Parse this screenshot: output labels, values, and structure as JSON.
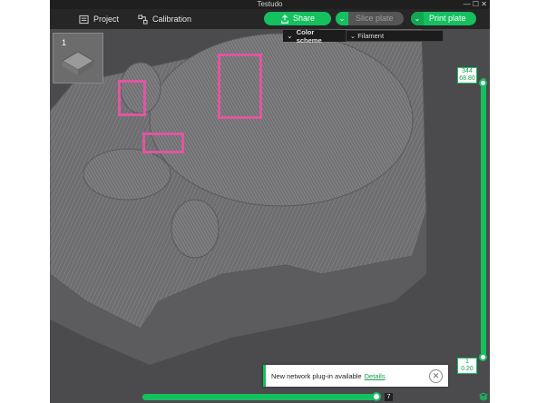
{
  "window": {
    "title": "Testudo",
    "min": "—",
    "max": "☐",
    "close": "✕"
  },
  "toolbar": {
    "project_label": "Project",
    "calibration_label": "Calibration",
    "share_label": "Share",
    "slice_label": "Slice plate",
    "print_label": "Print plate"
  },
  "plate": {
    "number": "1"
  },
  "color_scheme": {
    "label": "Color scheme",
    "value": "Filament"
  },
  "layer_slider": {
    "top_layer": "344",
    "top_height": "68.80",
    "bottom_layer": "1",
    "bottom_height": "0.20"
  },
  "move_slider": {
    "value": "7"
  },
  "toast": {
    "message": "New network plug-in available",
    "link": "Details"
  },
  "colors": {
    "accent": "#15c05f",
    "highlight": "#e0569f",
    "toolbar": "#262626"
  }
}
